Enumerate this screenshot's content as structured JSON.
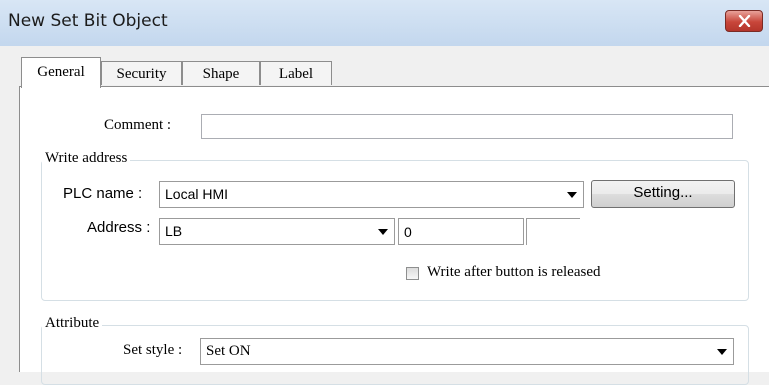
{
  "window": {
    "title": "New  Set Bit Object"
  },
  "tabs": [
    {
      "label": "General"
    },
    {
      "label": "Security"
    },
    {
      "label": "Shape"
    },
    {
      "label": "Label"
    }
  ],
  "general": {
    "comment": {
      "label": "Comment :",
      "value": ""
    },
    "write_address": {
      "group_label": "Write address",
      "plc_name": {
        "label": "PLC name :",
        "value": "Local HMI"
      },
      "setting_button": "Setting...",
      "address": {
        "label": "Address :",
        "type": "LB",
        "number": "0",
        "extra": ""
      },
      "write_after_release": {
        "label": "Write after button is released",
        "checked": false
      }
    },
    "attribute": {
      "group_label": "Attribute",
      "set_style": {
        "label": "Set style :",
        "value": "Set ON"
      }
    }
  }
}
